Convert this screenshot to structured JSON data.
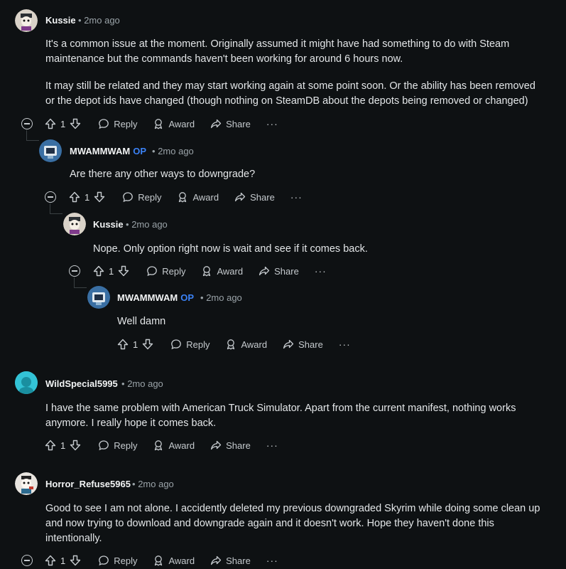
{
  "labels": {
    "reply": "Reply",
    "award": "Award",
    "share": "Share",
    "more": "···",
    "op": "OP",
    "dot": "•"
  },
  "comments": [
    {
      "author": "Kussie",
      "time": "2mo ago",
      "votes": "1",
      "lines": [
        "It's a common issue at the moment. Originally assumed it might have had something to do with Steam",
        "maintenance but the commands haven't been working for around 6 hours now.",
        "",
        "It may still be related and they may start working again at some point soon. Or the ability has been removed",
        "or the depot ids have changed (though nothing on SteamDB about the depots being removed or changed)"
      ]
    },
    {
      "author": "MWAMMWAM",
      "time": "2mo ago",
      "votes": "1",
      "op": true,
      "lines": [
        "Are there any other ways to downgrade?"
      ]
    },
    {
      "author": "Kussie",
      "time": "2mo ago",
      "votes": "1",
      "lines": [
        "Nope. Only option right now is wait and see if it comes back."
      ]
    },
    {
      "author": "MWAMMWAM",
      "time": "2mo ago",
      "votes": "1",
      "op": true,
      "lines": [
        "Well damn"
      ]
    },
    {
      "author": "WildSpecial5995",
      "time": "2mo ago",
      "votes": "1",
      "lines": [
        "I have the same problem with American Truck Simulator. Apart from the current manifest, nothing works",
        "anymore. I really hope it comes back."
      ]
    },
    {
      "author": "Horror_Refuse5965",
      "time": "2mo ago",
      "votes": "1",
      "lines": [
        "Good to see I am not alone. I accidently deleted my previous downgraded Skyrim while doing some clean up",
        "and now trying to download and downgrade again and it doesn't work. Hope they haven't done this",
        "intentionally."
      ]
    }
  ],
  "colors": {
    "background": "#0e1113",
    "op": "#3b82f6",
    "thread": "#3a4043"
  }
}
